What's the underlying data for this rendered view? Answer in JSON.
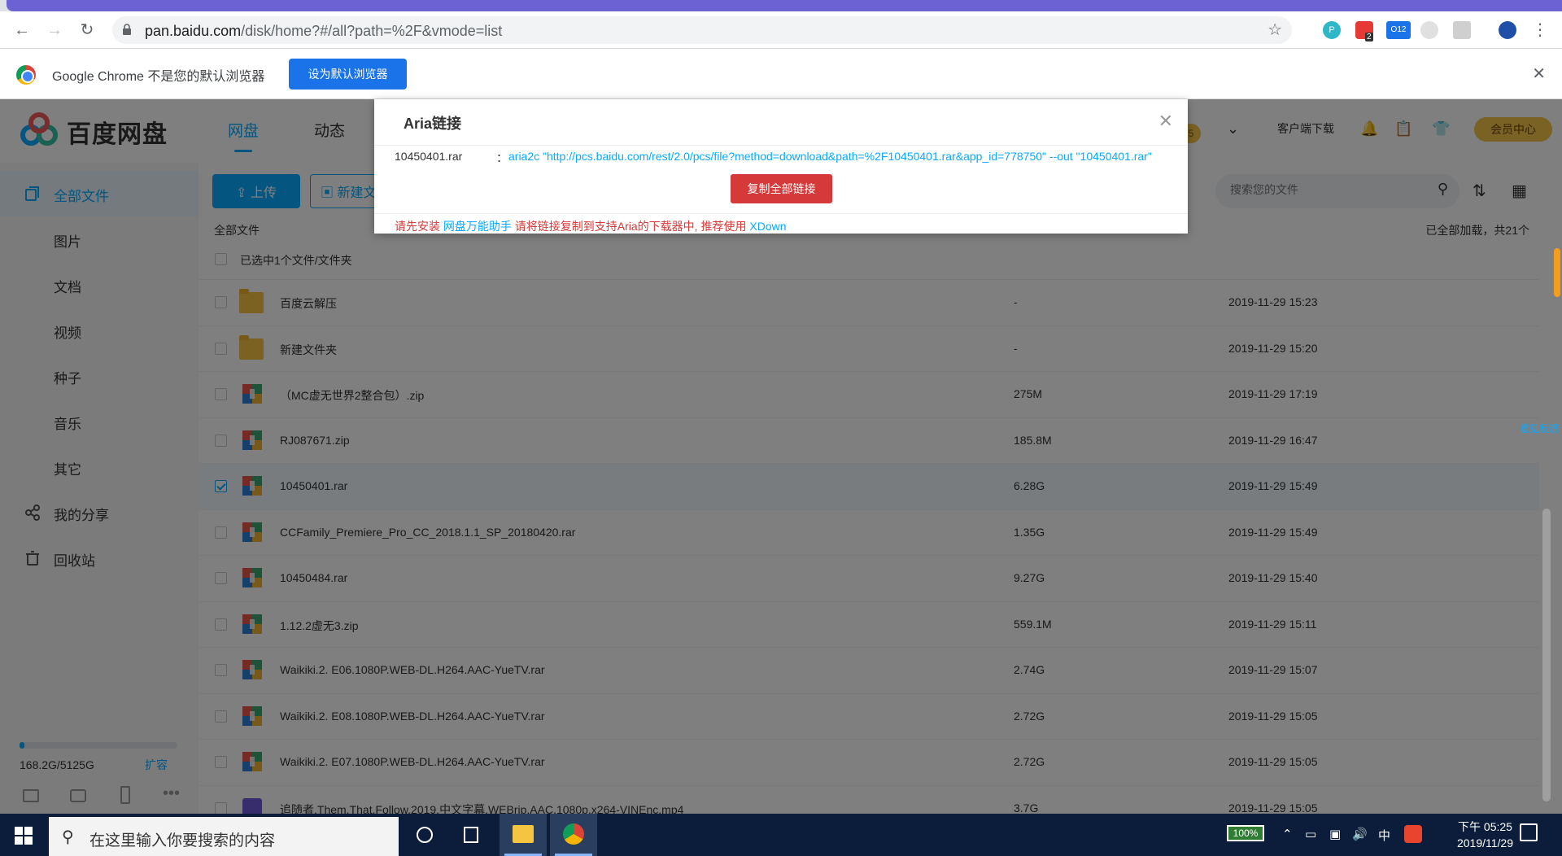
{
  "browser": {
    "url_host": "pan.baidu.com",
    "url_path": "/disk/home?#/all?path=%2F&vmode=list",
    "ext_badges": [
      "2",
      "O12"
    ]
  },
  "infobar": {
    "message": "Google Chrome 不是您的默认浏览器",
    "set_default_label": "设为默认浏览器"
  },
  "header": {
    "logo_text": "百度网盘",
    "nav": [
      "网盘",
      "动态"
    ],
    "client_download": "客户端下载",
    "vip_center": "会员中心",
    "coins": "5"
  },
  "sidebar": {
    "items": [
      "全部文件",
      "图片",
      "文档",
      "视频",
      "种子",
      "音乐",
      "其它",
      "我的分享",
      "回收站"
    ],
    "quota": "168.2G/5125G",
    "quota_fraction": 0.033,
    "expand": "扩容"
  },
  "toolbar": {
    "upload_label": "上传",
    "new_label": "新建文件夹",
    "search_placeholder": "搜索您的文件"
  },
  "list": {
    "breadcrumb": "全部文件",
    "loaded_text": "已全部加载，共21个",
    "selected_text": "已选中1个文件/文件夹",
    "rows": [
      {
        "name": "百度云解压",
        "size": "-",
        "date": "2019-11-29 15:23",
        "type": "folder",
        "checked": false
      },
      {
        "name": "新建文件夹",
        "size": "-",
        "date": "2019-11-29 15:20",
        "type": "folder",
        "checked": false
      },
      {
        "name": "（MC虚无世界2整合包）.zip",
        "size": "275M",
        "date": "2019-11-29 17:19",
        "type": "archive",
        "checked": false
      },
      {
        "name": "RJ087671.zip",
        "size": "185.8M",
        "date": "2019-11-29 16:47",
        "type": "archive",
        "checked": false
      },
      {
        "name": "10450401.rar",
        "size": "6.28G",
        "date": "2019-11-29 15:49",
        "type": "archive",
        "checked": true
      },
      {
        "name": "CCFamily_Premiere_Pro_CC_2018.1.1_SP_20180420.rar",
        "size": "1.35G",
        "date": "2019-11-29 15:49",
        "type": "archive",
        "checked": false
      },
      {
        "name": "10450484.rar",
        "size": "9.27G",
        "date": "2019-11-29 15:40",
        "type": "archive",
        "checked": false
      },
      {
        "name": "1.12.2虚无3.zip",
        "size": "559.1M",
        "date": "2019-11-29 15:11",
        "type": "archive",
        "checked": false
      },
      {
        "name": "Waikiki.2. E06.1080P.WEB-DL.H264.AAC-YueTV.rar",
        "size": "2.74G",
        "date": "2019-11-29 15:07",
        "type": "archive",
        "checked": false
      },
      {
        "name": "Waikiki.2. E08.1080P.WEB-DL.H264.AAC-YueTV.rar",
        "size": "2.72G",
        "date": "2019-11-29 15:05",
        "type": "archive",
        "checked": false
      },
      {
        "name": "Waikiki.2. E07.1080P.WEB-DL.H264.AAC-YueTV.rar",
        "size": "2.72G",
        "date": "2019-11-29 15:05",
        "type": "archive",
        "checked": false
      },
      {
        "name": "追随者.Them.That.Follow.2019.中文字幕.WEBrip.AAC.1080p.x264-VINEnc.mp4",
        "size": "3.7G",
        "date": "2019-11-29 15:05",
        "type": "video",
        "checked": false
      }
    ]
  },
  "dialog": {
    "title": "Aria链接",
    "file": "10450401.rar",
    "colon": "：",
    "link": "aria2c \"http://pcs.baidu.com/rest/2.0/pcs/file?method=download&path=%2F10450401.rar&app_id=778750\" --out \"10450401.rar\"",
    "copy_label": "复制全部链接",
    "tip_1": "请先安装",
    "tip_link1": "网盘万能助手",
    "tip_2": "请将链接复制到支持Aria的下载器中, 推荐使用",
    "tip_link2": "XDown"
  },
  "side_tag": "意见反馈",
  "taskbar": {
    "search_placeholder": "在这里输入你要搜索的内容",
    "battery": "100%",
    "ime": "中",
    "time": "下午 05:25",
    "date": "2019/11/29"
  }
}
